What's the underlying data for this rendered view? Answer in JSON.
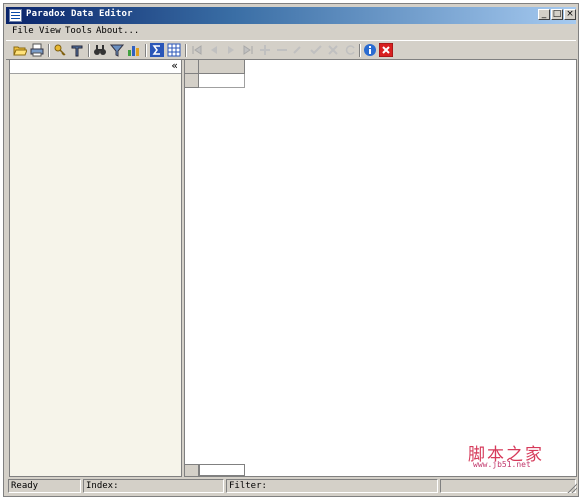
{
  "window": {
    "title": "Paradox Data Editor",
    "minimize": "_",
    "maximize": "□",
    "close": "×"
  },
  "menu": {
    "file": "File",
    "view": "View",
    "tools": "Tools",
    "about": "About..."
  },
  "toolbar": {
    "icons": [
      "open-folder",
      "print",
      "key",
      "tools",
      "binoculars",
      "filter",
      "chart",
      "sum",
      "table",
      "nav-first",
      "nav-prior",
      "nav-next",
      "nav-last",
      "insert",
      "delete",
      "edit",
      "post",
      "cancel",
      "refresh",
      "info",
      "close"
    ]
  },
  "left_panel": {
    "collapse_glyph": "«"
  },
  "status": {
    "ready": "Ready",
    "index": "Index:",
    "filter": "Filter:"
  },
  "watermark": {
    "title": "脚本之家",
    "url": "www.jb51.net"
  },
  "colors": {
    "title_start": "#0a246a",
    "title_end": "#a6caf0",
    "panel_bg": "#f6f4ea",
    "chrome": "#d4d0c8"
  }
}
